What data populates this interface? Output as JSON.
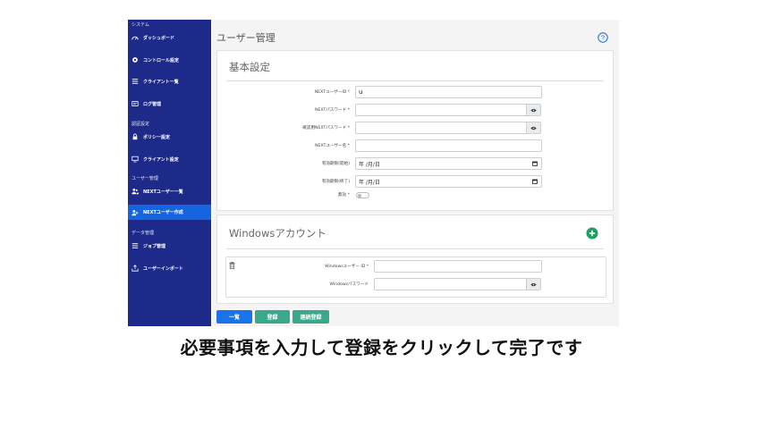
{
  "sidebar": {
    "sections": [
      {
        "label": "システム"
      },
      {
        "label": "認証設定"
      },
      {
        "label": "ユーザー管理"
      },
      {
        "label": "データ管理"
      }
    ],
    "items": [
      {
        "label": "ダッシュボード",
        "icon": "dashboard-icon"
      },
      {
        "label": "コントロール設定",
        "icon": "gear-icon"
      },
      {
        "label": "クライアント一覧",
        "icon": "list-icon"
      },
      {
        "label": "ログ管理",
        "icon": "log-icon"
      },
      {
        "label": "ポリシー設定",
        "icon": "lock-icon"
      },
      {
        "label": "クライアント設定",
        "icon": "monitor-icon"
      },
      {
        "label": "NEXTユーザー一覧",
        "icon": "users-icon"
      },
      {
        "label": "NEXTユーザー作成",
        "icon": "user-add-icon",
        "active": true
      },
      {
        "label": "ジョブ管理",
        "icon": "list-icon"
      },
      {
        "label": "ユーザーインポート",
        "icon": "upload-icon"
      }
    ]
  },
  "main": {
    "title": "ユーザー管理",
    "basic": {
      "title": "基本設定",
      "fields": [
        {
          "label": "NEXTユーザーID *",
          "value": "u"
        },
        {
          "label": "NEXTパスワード *",
          "value": ""
        },
        {
          "label": "確認用NEXTパスワード *",
          "value": ""
        },
        {
          "label": "NEXTユーザー名 *",
          "value": ""
        },
        {
          "label": "有効期限(開始)",
          "value": "年 /月/日"
        },
        {
          "label": "有効期限(終了)",
          "value": "年 /月/日"
        },
        {
          "label": "無効 *",
          "value": ""
        }
      ]
    },
    "windows": {
      "title": "Windowsアカウント",
      "fields": [
        {
          "label": "Windowsユーザー ID *",
          "value": ""
        },
        {
          "label": "Windowsパスワード",
          "value": ""
        }
      ]
    },
    "buttons": {
      "list": "一覧",
      "register": "登録",
      "continuous": "連続登録"
    }
  },
  "caption": "必要事項を入力して登録をクリックして完了です",
  "colors": {
    "sidebar": "#1d2a8a",
    "active": "#1665e0",
    "green": "#1e9e63",
    "teal": "#3aa88a",
    "blue_button": "#1874e8"
  }
}
